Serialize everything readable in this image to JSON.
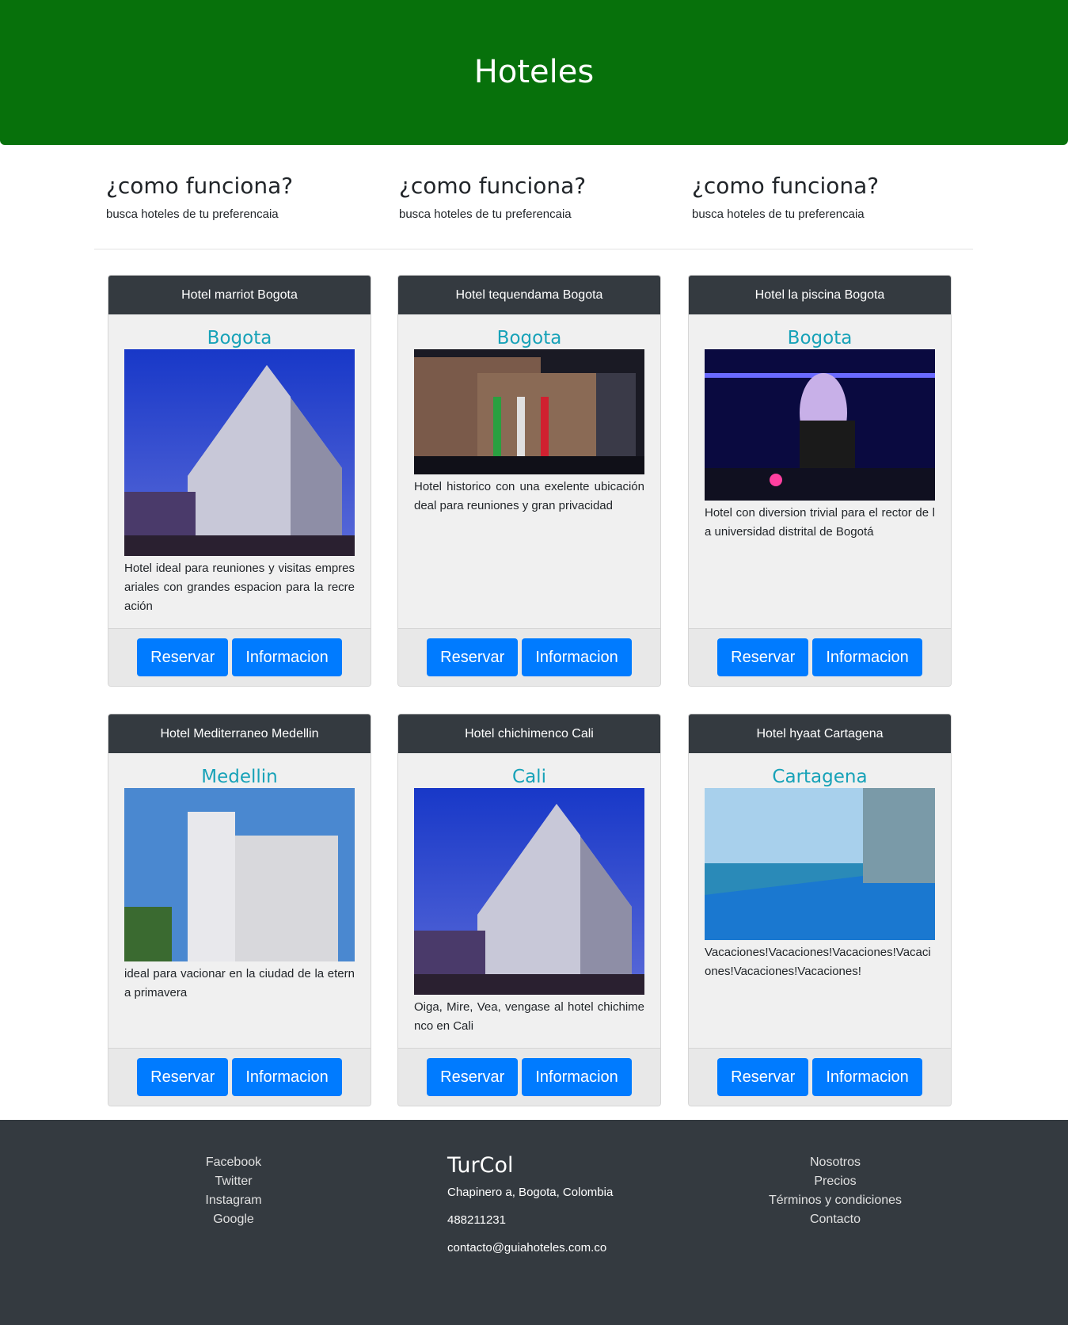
{
  "header": {
    "title": "Hoteles"
  },
  "features": [
    {
      "title": "¿como funciona?",
      "text": "busca hoteles de tu preferencaia"
    },
    {
      "title": "¿como funciona?",
      "text": "busca hoteles de tu preferencaia"
    },
    {
      "title": "¿como funciona?",
      "text": "busca hoteles de tu preferencaia"
    }
  ],
  "hotels": [
    {
      "name": "Hotel marriot Bogota",
      "city": "Bogota",
      "description": "Hotel ideal para reuniones y visitas empresariales con grandes espacion para la recreación",
      "reserve_label": "Reservar",
      "info_label": "Informacion"
    },
    {
      "name": "Hotel tequendama Bogota",
      "city": "Bogota",
      "description": "Hotel historico con una exelente ubicación deal para reuniones y gran privacidad",
      "reserve_label": "Reservar",
      "info_label": "Informacion"
    },
    {
      "name": "Hotel la piscina Bogota",
      "city": "Bogota",
      "description": "Hotel con diversion trivial para el rector de la universidad distrital de Bogotá",
      "reserve_label": "Reservar",
      "info_label": "Informacion"
    },
    {
      "name": "Hotel Mediterraneo Medellin",
      "city": "Medellin",
      "description": "ideal para vacionar en la ciudad de la eterna primavera",
      "reserve_label": "Reservar",
      "info_label": "Informacion"
    },
    {
      "name": "Hotel chichimenco Cali",
      "city": "Cali",
      "description": "Oiga, Mire, Vea, vengase al hotel chichimenco en Cali",
      "reserve_label": "Reservar",
      "info_label": "Informacion"
    },
    {
      "name": "Hotel hyaat Cartagena",
      "city": "Cartagena",
      "description": "Vacaciones!Vacaciones!Vacaciones!Vacaciones!Vacaciones!Vacaciones!",
      "reserve_label": "Reservar",
      "info_label": "Informacion"
    }
  ],
  "footer": {
    "social": [
      "Facebook",
      "Twitter",
      "Instagram",
      "Google"
    ],
    "brand": "TurCol",
    "address": "Chapinero a, Bogota, Colombia",
    "phone": "488211231",
    "email": "contacto@guiahoteles.com.co",
    "links": [
      "Nosotros",
      "Precios",
      "Términos y condiciones",
      "Contacto"
    ]
  }
}
